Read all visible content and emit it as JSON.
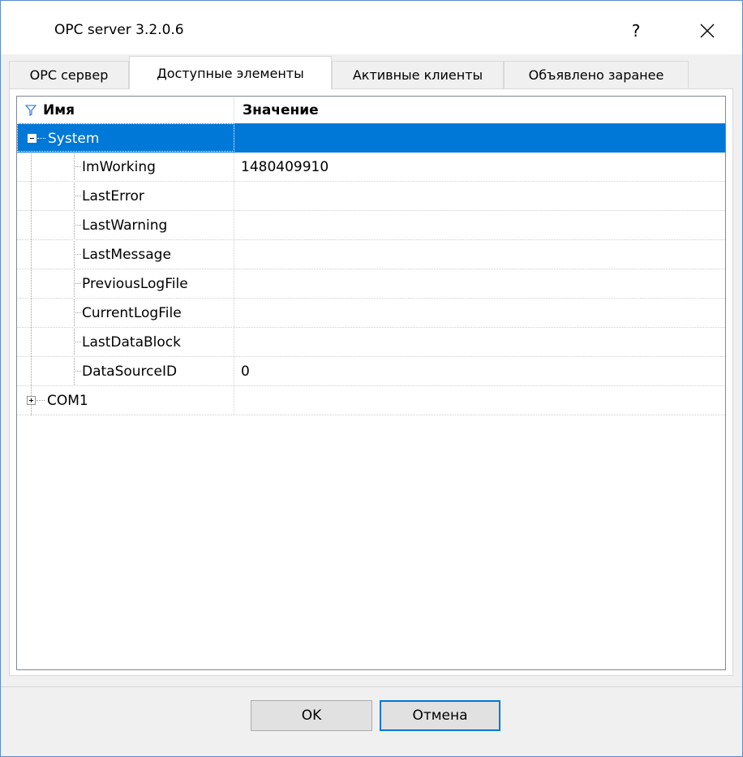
{
  "window": {
    "title": "OPC server 3.2.0.6",
    "help_label": "?"
  },
  "tabs": [
    {
      "label": "OPC сервер",
      "active": false
    },
    {
      "label": "Доступные элементы",
      "active": true
    },
    {
      "label": "Активные клиенты",
      "active": false
    },
    {
      "label": "Объявлено заранее",
      "active": false
    }
  ],
  "tree": {
    "columns": {
      "name": "Имя",
      "value": "Значение"
    },
    "nodes": [
      {
        "name": "System",
        "value": "",
        "selected": true,
        "expanded": true
      },
      {
        "name": "ImWorking",
        "value": "1480409910"
      },
      {
        "name": "LastError",
        "value": ""
      },
      {
        "name": "LastWarning",
        "value": ""
      },
      {
        "name": "LastMessage",
        "value": ""
      },
      {
        "name": "PreviousLogFile",
        "value": ""
      },
      {
        "name": "CurrentLogFile",
        "value": ""
      },
      {
        "name": "LastDataBlock",
        "value": ""
      },
      {
        "name": "DataSourceID",
        "value": "0"
      },
      {
        "name": "COM1",
        "value": "",
        "expanded": false
      }
    ]
  },
  "buttons": {
    "ok_label": "OK",
    "cancel_label": "Отмена"
  },
  "colors": {
    "selection": "#0078d7",
    "window_border": "#5a8ad0",
    "default_button_border": "#0078d7"
  }
}
